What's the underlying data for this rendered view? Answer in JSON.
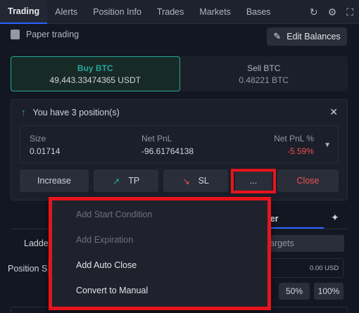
{
  "tabs": [
    "Trading",
    "Alerts",
    "Position Info",
    "Trades",
    "Markets",
    "Bases"
  ],
  "tab_icons": [
    "refresh-icon",
    "gear-icon",
    "expand-icon"
  ],
  "paper_trading": {
    "label": "Paper trading",
    "edit_label": "Edit Balances"
  },
  "buy": {
    "title": "Buy BTC",
    "value": "49,443.33474365 USDT"
  },
  "sell": {
    "title": "Sell BTC",
    "value": "0.48221 BTC"
  },
  "position": {
    "header": "You have 3 position(s)",
    "size_label": "Size",
    "size_value": "0.01714",
    "pnl_label": "Net PnL",
    "pnl_value": "-96.61764138",
    "pct_label": "Net PnL %",
    "pct_value": "-5.59%"
  },
  "actions": {
    "increase": "Increase",
    "tp": "TP",
    "sl": "SL",
    "more": "...",
    "close": "Close"
  },
  "menu": {
    "items": [
      {
        "label": "Add Start Condition",
        "enabled": false
      },
      {
        "label": "Add Expiration",
        "enabled": false
      },
      {
        "label": "Add Auto Close",
        "enabled": true
      },
      {
        "label": "Convert to Manual",
        "enabled": true
      }
    ]
  },
  "background": {
    "order_tab": "der",
    "ladder": "Ladde",
    "targets": "argets",
    "position_size": "Position Si",
    "usd_value": "0.00 USD",
    "pct_50": "50%",
    "pct_100": "100%"
  },
  "colors": {
    "accent": "#2962ff",
    "buy": "#26a69a",
    "sell": "#ef5350",
    "highlight": "#e8141b"
  }
}
